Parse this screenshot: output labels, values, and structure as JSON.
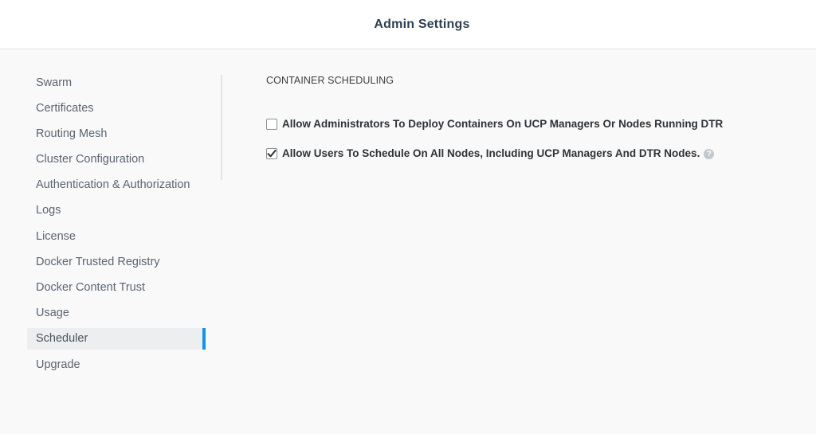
{
  "header": {
    "title": "Admin Settings"
  },
  "sidebar": {
    "items": [
      {
        "label": "Swarm"
      },
      {
        "label": "Certificates"
      },
      {
        "label": "Routing Mesh"
      },
      {
        "label": "Cluster Configuration"
      },
      {
        "label": "Authentication & Authorization"
      },
      {
        "label": "Logs"
      },
      {
        "label": "License"
      },
      {
        "label": "Docker Trusted Registry"
      },
      {
        "label": "Docker Content Trust"
      },
      {
        "label": "Usage"
      },
      {
        "label": "Scheduler"
      },
      {
        "label": "Upgrade"
      }
    ],
    "active": "Scheduler"
  },
  "content": {
    "section_title": "CONTAINER SCHEDULING",
    "options": [
      {
        "label": "Allow Administrators To Deploy Containers On UCP Managers Or Nodes Running DTR",
        "checked": false
      },
      {
        "label": "Allow Users To Schedule On All Nodes, Including UCP Managers And DTR Nodes.",
        "checked": true,
        "help": "?"
      }
    ]
  },
  "colors": {
    "accent": "#1593e6",
    "active_bg": "#eceeef"
  },
  "icons": {
    "checkmark": "checkmark-icon",
    "help": "help-icon"
  }
}
